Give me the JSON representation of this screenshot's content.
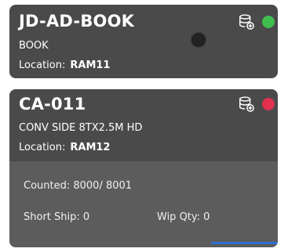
{
  "cards": [
    {
      "code": "JD-AD-BOOK",
      "description": "BOOK",
      "location_label": "Location:",
      "location_value": "RAM11",
      "status_color": "#3fbf4f",
      "icon": "database-add-icon"
    },
    {
      "code": "CA-011",
      "description": "CONV SIDE 8TX2.5M HD",
      "location_label": "Location:",
      "location_value": "RAM12",
      "status_color": "#e0314f",
      "icon": "database-add-icon",
      "counted": "Counted: 8000/ 8001",
      "short_ship": "Short Ship: 0",
      "wip_qty": "Wip Qty: 0",
      "progress_color": "#2f6fd6"
    }
  ]
}
